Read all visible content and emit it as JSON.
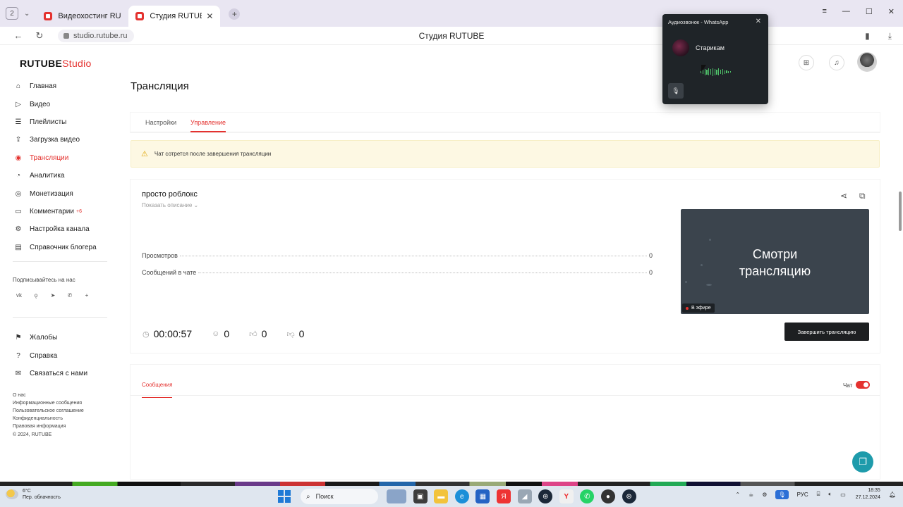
{
  "browser": {
    "tab_count": "2",
    "tabs": [
      {
        "label": "Видеохостинг RUTUBE. С"
      },
      {
        "label": "Студия RUTUBE"
      }
    ],
    "url": "studio.rutube.ru",
    "page_title": "Студия RUTUBE"
  },
  "logo": {
    "brand": "RUTUBE",
    "suffix": "Studio"
  },
  "sidebar": {
    "items": [
      {
        "label": "Главная",
        "icon": "home-icon"
      },
      {
        "label": "Видео",
        "icon": "video-icon"
      },
      {
        "label": "Плейлисты",
        "icon": "playlist-icon"
      },
      {
        "label": "Загрузка видео",
        "icon": "upload-icon"
      },
      {
        "label": "Трансляции",
        "icon": "broadcast-icon"
      },
      {
        "label": "Аналитика",
        "icon": "analytics-icon"
      },
      {
        "label": "Монетизация",
        "icon": "money-icon"
      },
      {
        "label": "Комментарии",
        "badge": "+6",
        "icon": "comment-icon"
      },
      {
        "label": "Настройка канала",
        "icon": "settings-icon"
      },
      {
        "label": "Справочник блогера",
        "icon": "book-icon"
      }
    ],
    "active_index": 4,
    "subscribe_label": "Подписывайтесь на нас",
    "socials": [
      "vk",
      "ok",
      "telegram",
      "viber",
      "plus"
    ],
    "secondary": [
      {
        "label": "Жалобы",
        "icon": "flag-icon"
      },
      {
        "label": "Справка",
        "icon": "help-icon"
      },
      {
        "label": "Связаться с нами",
        "icon": "mail-icon"
      }
    ],
    "footer_links": [
      "О нас",
      "Информационные сообщения",
      "Пользовательское соглашение",
      "Конфиденциальность",
      "Правовая информация"
    ],
    "copyright": "© 2024, RUTUBE"
  },
  "main": {
    "title": "Трансляция",
    "tabs": [
      {
        "label": "Настройки"
      },
      {
        "label": "Управление"
      }
    ],
    "active_tab": 1,
    "notice": "Чат сотрется после завершения трансляции",
    "stream": {
      "name": "просто роблокс",
      "show_description": "Показать описание",
      "stats": [
        {
          "label": "Просмотров",
          "value": "0"
        },
        {
          "label": "Сообщений в чате",
          "value": "0"
        }
      ],
      "preview_text_line1": "Смотри",
      "preview_text_line2": "трансляцию",
      "live_badge": "В эфире",
      "end_button": "Завершить трансляцию",
      "timer": "00:00:57",
      "viewers": "0",
      "likes": "0",
      "dislikes": "0"
    },
    "messages_tab": "Сообщения",
    "chat_label": "Чат",
    "chat_enabled": true
  },
  "whatsapp_popup": {
    "title": "Аудиозвонок - WhatsApp",
    "contact": "Старикам"
  },
  "taskbar": {
    "temperature": "6°C",
    "weather": "Пер. облачность",
    "search": "Поиск",
    "language": "РУС",
    "time": "18:35",
    "date": "27.12.2024"
  },
  "colors": {
    "accent": "#e4322f",
    "notice_bg": "#fdf8e3",
    "help_fab": "#1e9bab"
  }
}
